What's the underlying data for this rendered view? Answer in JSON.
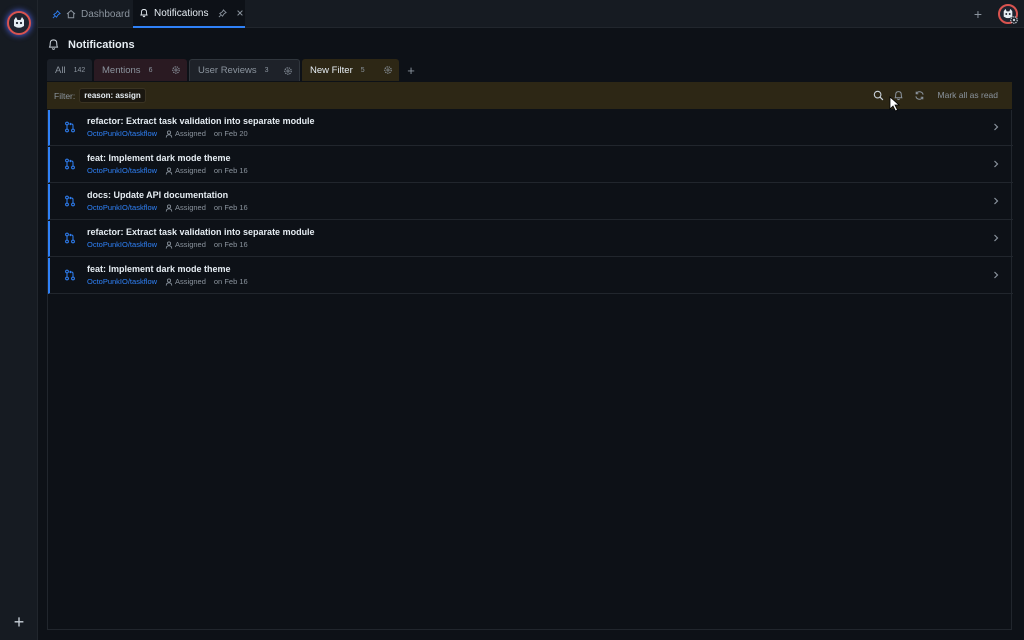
{
  "rail": {
    "add_label": "+"
  },
  "topbar": {
    "tabs": [
      {
        "label": "Dashboard",
        "icon": "home-icon",
        "pinned": true
      },
      {
        "label": "Notifications",
        "icon": "bell-icon",
        "pinned": true,
        "closeable": true,
        "active": true
      }
    ],
    "add_label": "+"
  },
  "page": {
    "title": "Notifications"
  },
  "filter_tabs": [
    {
      "label": "All",
      "count": "142"
    },
    {
      "label": "Mentions",
      "count": "6"
    },
    {
      "label": "User Reviews",
      "count": "3"
    },
    {
      "label": "New Filter",
      "count": "5",
      "active": true
    }
  ],
  "filter_tabs_add": "+",
  "filterbar": {
    "label": "Filter:",
    "chip": "reason: assign",
    "mark_all_read": "Mark all as read"
  },
  "notifications": [
    {
      "title": "refactor: Extract task validation into separate module",
      "repo": "OctoPunkIO/taskflow",
      "reason": "Assigned",
      "date": "on Feb 20"
    },
    {
      "title": "feat: Implement dark mode theme",
      "repo": "OctoPunkIO/taskflow",
      "reason": "Assigned",
      "date": "on Feb 16"
    },
    {
      "title": "docs: Update API documentation",
      "repo": "OctoPunkIO/taskflow",
      "reason": "Assigned",
      "date": "on Feb 16"
    },
    {
      "title": "refactor: Extract task validation into separate module",
      "repo": "OctoPunkIO/taskflow",
      "reason": "Assigned",
      "date": "on Feb 16"
    },
    {
      "title": "feat: Implement dark mode theme",
      "repo": "OctoPunkIO/taskflow",
      "reason": "Assigned",
      "date": "on Feb 16"
    }
  ],
  "colors": {
    "accent": "#2f81f7",
    "background": "#0d1117",
    "filter_bar": "#2d2715",
    "mentions_tab": "#2a1a22",
    "avatar_ring": "#d9534f"
  }
}
